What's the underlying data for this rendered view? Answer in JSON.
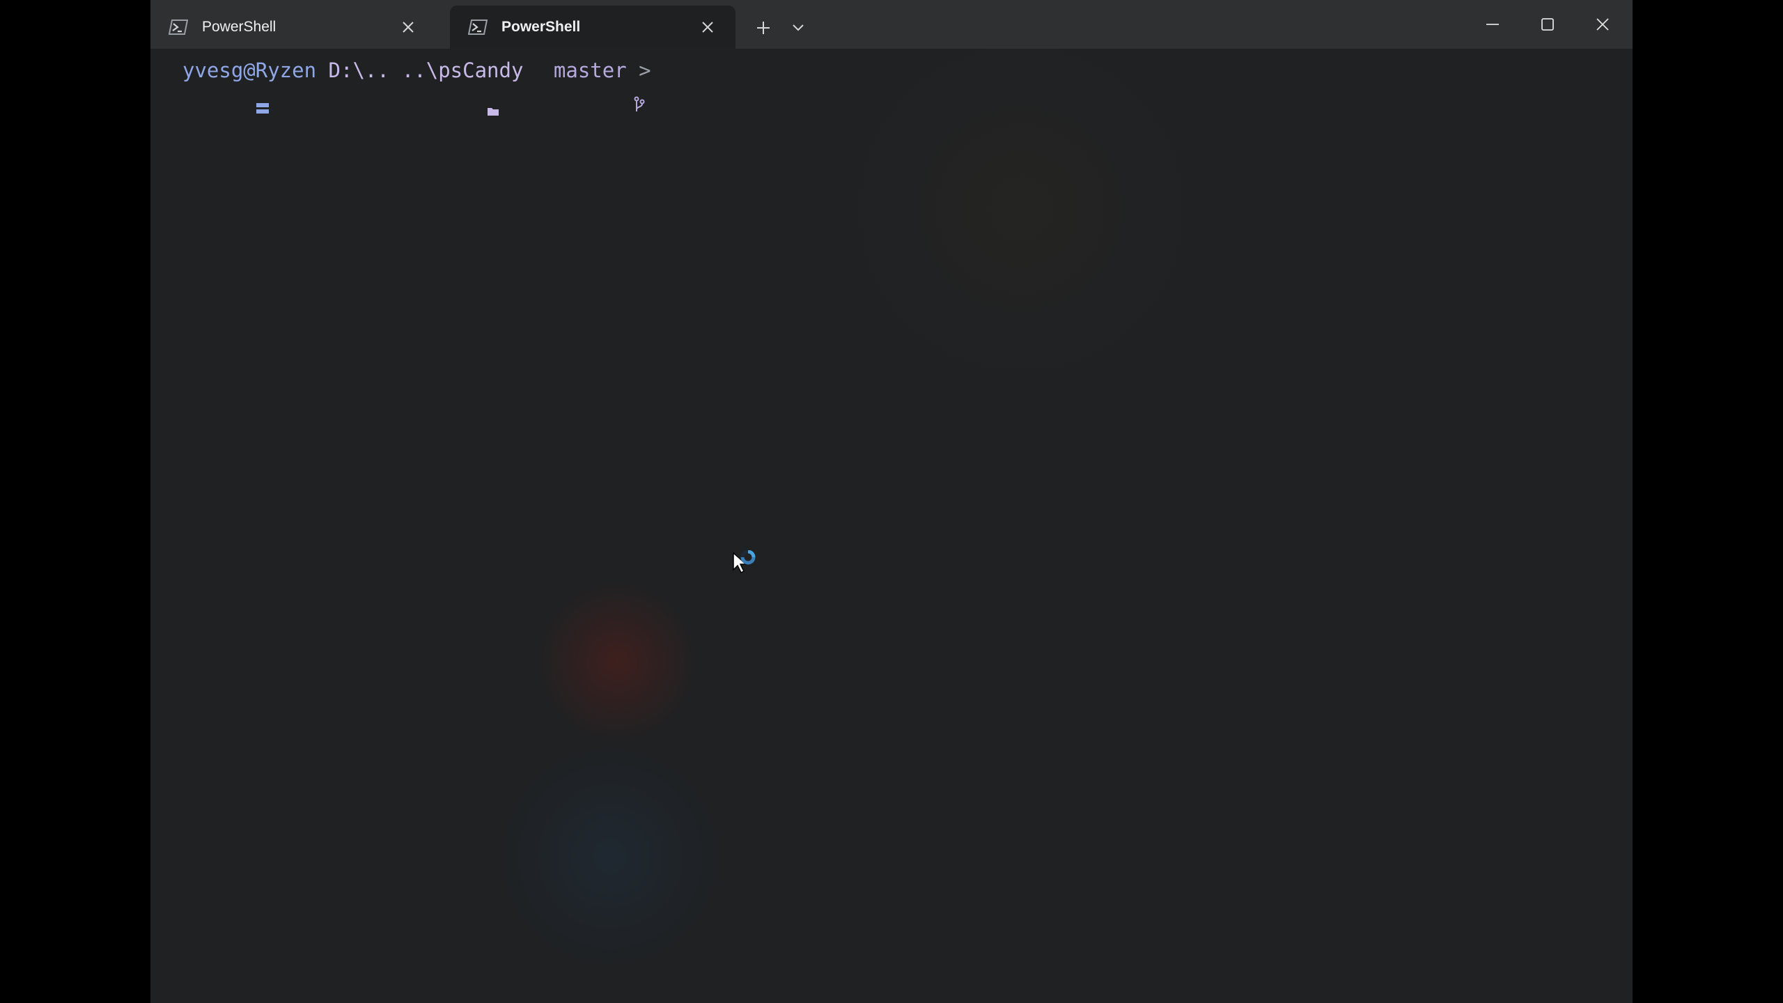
{
  "tabs": [
    {
      "title": "PowerShell",
      "active": false
    },
    {
      "title": "PowerShell",
      "active": true
    }
  ],
  "prompt": {
    "user_host": "yvesg@Ryzen",
    "path_part1": "D:\\..",
    "path_part2": "..\\psCandy",
    "branch": "master",
    "caret": ">"
  },
  "colors": {
    "user": "#8fa7e6",
    "path": "#c8b9e8",
    "accent_busy": "#4ba3e3"
  },
  "icons": {
    "tab": "powershell-icon",
    "close": "close-icon",
    "new_tab": "plus-icon",
    "dropdown": "chevron-down-icon",
    "minimize": "minimize-icon",
    "maximize": "maximize-icon",
    "window_close": "close-icon",
    "folder": "folder-icon",
    "branch": "git-branch-icon",
    "cursor": "busy-cursor-icon"
  }
}
